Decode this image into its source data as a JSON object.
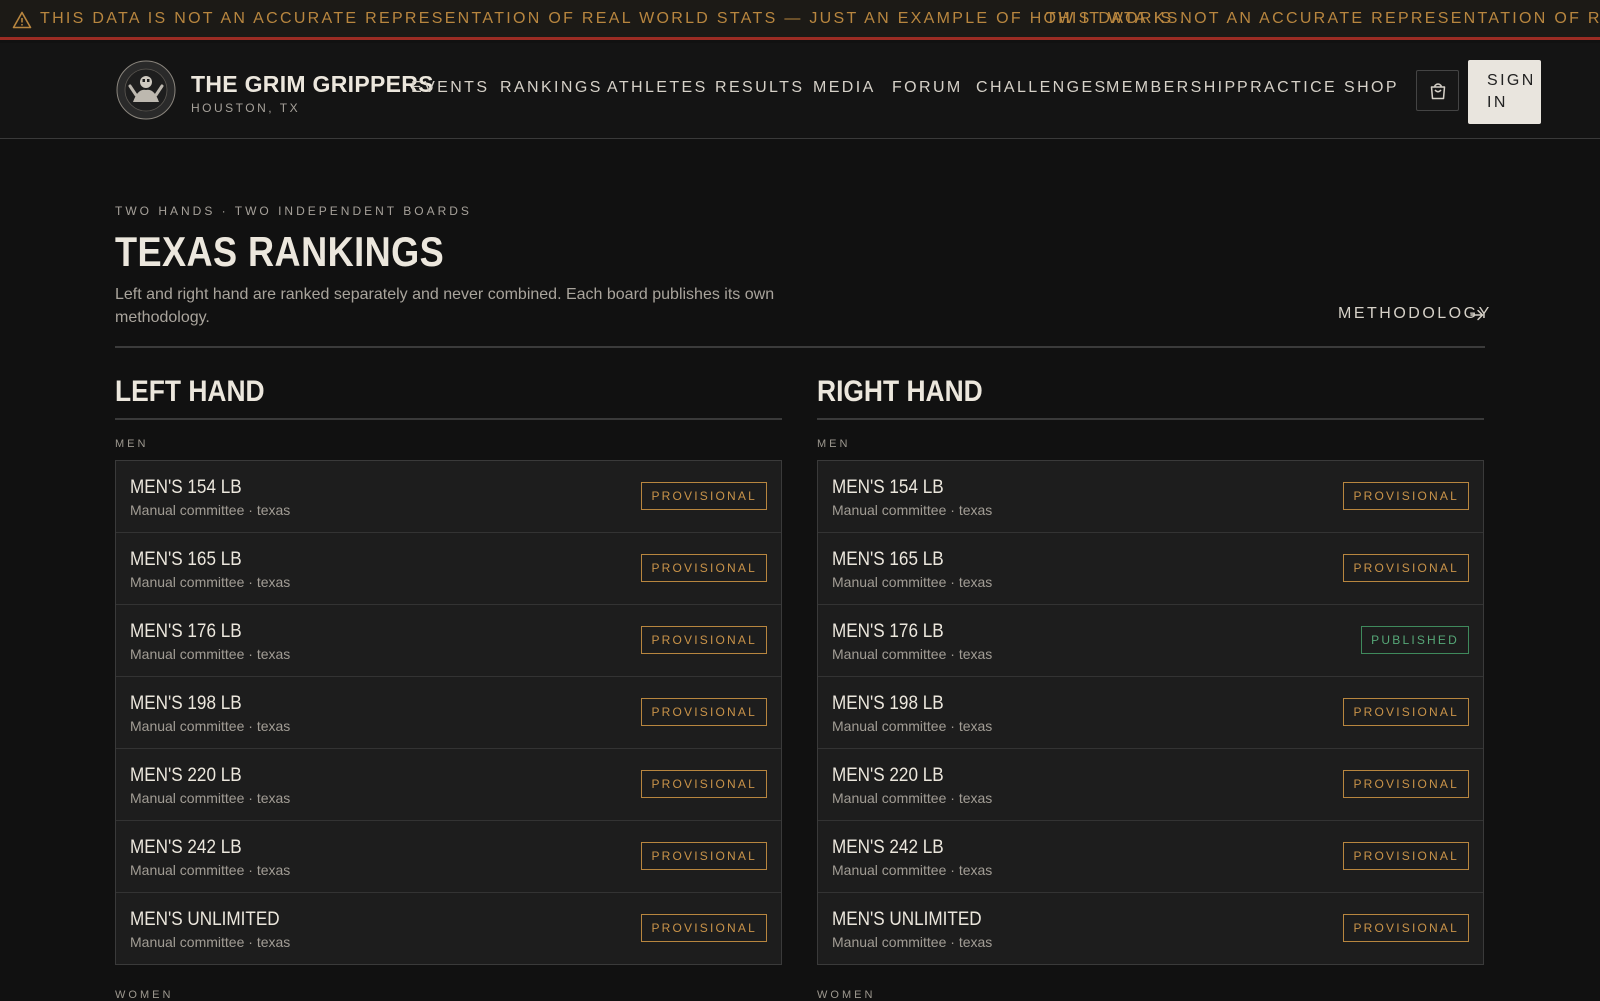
{
  "ticker": {
    "message": "THIS DATA IS NOT AN ACCURATE REPRESENTATION OF REAL WORLD STATS — JUST AN EXAMPLE OF HOW IT WORKS.",
    "message_repeat": "THIS DATA IS NOT AN ACCURATE REPRESENTATION OF REAL WORLD STATS — JUST AN EXAMPLE OF HOW IT WORKS.",
    "icon": "warning-icon"
  },
  "brand": {
    "name": "THE GRIM GRIPPERS",
    "city": "HOUSTON, TX",
    "logo_ring_top": "THE GRIM GRIPPERS",
    "logo_ring_bottom": "GRIP TO YOU'RE GRIM"
  },
  "nav": {
    "items": [
      {
        "label": "EVENTS"
      },
      {
        "label": "RANKINGS"
      },
      {
        "label": "ATHLETES"
      },
      {
        "label": "RESULTS"
      },
      {
        "label": "MEDIA"
      },
      {
        "label": "FORUM"
      },
      {
        "label": "CHALLENGES"
      },
      {
        "label": "MEMBERSHIP"
      },
      {
        "label": "PRACTICE"
      },
      {
        "label": "SHOP"
      }
    ],
    "cart_icon": "shopping-bag-icon",
    "signin_label": "SIGN IN"
  },
  "hero": {
    "eyebrow": "TWO HANDS · TWO INDEPENDENT BOARDS",
    "title": "TEXAS RANKINGS",
    "intro": "Left and right hand are ranked separately and never combined. Each board publishes its own methodology.",
    "methodology_label": "METHODOLOGY"
  },
  "boards": {
    "left": {
      "title": "LEFT HAND",
      "group_men": "MEN",
      "group_women": "WOMEN",
      "rows": [
        {
          "title": "MEN'S 154 LB",
          "sub": "Manual committee · texas",
          "status": "PROVISIONAL"
        },
        {
          "title": "MEN'S 165 LB",
          "sub": "Manual committee · texas",
          "status": "PROVISIONAL"
        },
        {
          "title": "MEN'S 176 LB",
          "sub": "Manual committee · texas",
          "status": "PROVISIONAL"
        },
        {
          "title": "MEN'S 198 LB",
          "sub": "Manual committee · texas",
          "status": "PROVISIONAL"
        },
        {
          "title": "MEN'S 220 LB",
          "sub": "Manual committee · texas",
          "status": "PROVISIONAL"
        },
        {
          "title": "MEN'S 242 LB",
          "sub": "Manual committee · texas",
          "status": "PROVISIONAL"
        },
        {
          "title": "MEN'S UNLIMITED",
          "sub": "Manual committee · texas",
          "status": "PROVISIONAL"
        }
      ]
    },
    "right": {
      "title": "RIGHT HAND",
      "group_men": "MEN",
      "group_women": "WOMEN",
      "rows": [
        {
          "title": "MEN'S 154 LB",
          "sub": "Manual committee · texas",
          "status": "PROVISIONAL"
        },
        {
          "title": "MEN'S 165 LB",
          "sub": "Manual committee · texas",
          "status": "PROVISIONAL"
        },
        {
          "title": "MEN'S 176 LB",
          "sub": "Manual committee · texas",
          "status": "PUBLISHED"
        },
        {
          "title": "MEN'S 198 LB",
          "sub": "Manual committee · texas",
          "status": "PROVISIONAL"
        },
        {
          "title": "MEN'S 220 LB",
          "sub": "Manual committee · texas",
          "status": "PROVISIONAL"
        },
        {
          "title": "MEN'S 242 LB",
          "sub": "Manual committee · texas",
          "status": "PROVISIONAL"
        },
        {
          "title": "MEN'S UNLIMITED",
          "sub": "Manual committee · texas",
          "status": "PROVISIONAL"
        }
      ]
    }
  },
  "colors": {
    "provisional": "#c99349",
    "published": "#56a878",
    "ticker_border": "#9b2c23"
  }
}
